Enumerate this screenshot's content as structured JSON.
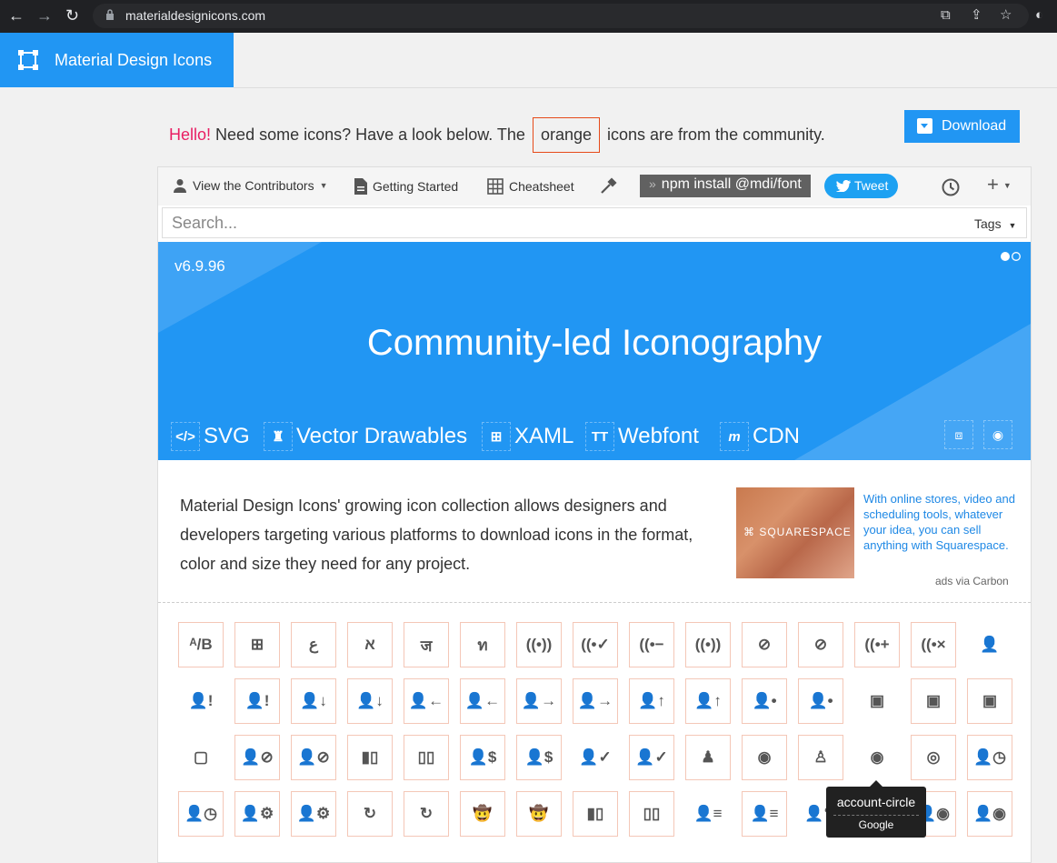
{
  "browser": {
    "url": "materialdesignicons.com"
  },
  "header": {
    "brand": "Material Design Icons"
  },
  "intro": {
    "hello": "Hello!",
    "before": "Need some icons? Have a look below. The",
    "orange": "orange",
    "after": "icons are from the community."
  },
  "download_label": "Download",
  "toolbar": {
    "contributors": "View the Contributors",
    "getting_started": "Getting Started",
    "cheatsheet": "Cheatsheet",
    "npm": "npm install @mdi/font",
    "tweet": "Tweet"
  },
  "search": {
    "placeholder": "Search...",
    "tags_label": "Tags"
  },
  "hero": {
    "version": "v6.9.96",
    "headline": "Community-led Iconography",
    "platforms": [
      "SVG",
      "Vector Drawables",
      "XAML",
      "Webfont",
      "CDN"
    ]
  },
  "description": "Material Design Icons' growing icon collection allows designers and developers targeting various platforms to download icons in the format, color and size they need for any project.",
  "ad": {
    "brand": "SQUARESPACE",
    "text": "With online stores, video and scheduling tools, whatever your idea, you can sell anything with Squarespace.",
    "via": "ads via Carbon"
  },
  "tooltip": {
    "name": "account-circle",
    "author": "Google"
  },
  "icon_rows": [
    [
      {
        "icon": "ab-testing-icon",
        "glyph": "ᴬ/B",
        "community": true
      },
      {
        "icon": "abacus-icon",
        "glyph": "⊞",
        "community": true
      },
      {
        "icon": "abjad-arabic-icon",
        "glyph": "ع",
        "community": true
      },
      {
        "icon": "abjad-hebrew-icon",
        "glyph": "א",
        "community": true
      },
      {
        "icon": "abugida-devanagari-icon",
        "glyph": "ज",
        "community": true
      },
      {
        "icon": "abugida-thai-icon",
        "glyph": "ท",
        "community": true
      },
      {
        "icon": "access-point-icon",
        "glyph": "((•))",
        "community": true
      },
      {
        "icon": "access-point-check-icon",
        "glyph": "((•✓",
        "community": true
      },
      {
        "icon": "access-point-minus-icon",
        "glyph": "((•−",
        "community": true
      },
      {
        "icon": "access-point-network-icon",
        "glyph": "((•))",
        "community": true
      },
      {
        "icon": "access-point-network-off-icon",
        "glyph": "⊘",
        "community": true
      },
      {
        "icon": "access-point-off-icon",
        "glyph": "⊘",
        "community": true
      },
      {
        "icon": "access-point-plus-icon",
        "glyph": "((•+",
        "community": true
      },
      {
        "icon": "access-point-remove-icon",
        "glyph": "((•×",
        "community": true
      },
      {
        "icon": "account-icon",
        "glyph": "👤",
        "community": false
      }
    ],
    [
      {
        "icon": "account-alert-icon",
        "glyph": "👤!",
        "community": false
      },
      {
        "icon": "account-alert-outline-icon",
        "glyph": "👤!",
        "community": true
      },
      {
        "icon": "account-arrow-down-icon",
        "glyph": "👤↓",
        "community": true
      },
      {
        "icon": "account-arrow-down-outline-icon",
        "glyph": "👤↓",
        "community": true
      },
      {
        "icon": "account-arrow-left-icon",
        "glyph": "👤←",
        "community": true
      },
      {
        "icon": "account-arrow-left-outline-icon",
        "glyph": "👤←",
        "community": true
      },
      {
        "icon": "account-arrow-right-icon",
        "glyph": "👤→",
        "community": true
      },
      {
        "icon": "account-arrow-right-outline-icon",
        "glyph": "👤→",
        "community": true
      },
      {
        "icon": "account-arrow-up-icon",
        "glyph": "👤↑",
        "community": true
      },
      {
        "icon": "account-arrow-up-outline-icon",
        "glyph": "👤↑",
        "community": true
      },
      {
        "icon": "account-badge-icon",
        "glyph": "👤•",
        "community": true
      },
      {
        "icon": "account-badge-outline-icon",
        "glyph": "👤•",
        "community": true
      },
      {
        "icon": "account-box-icon",
        "glyph": "▣",
        "community": false
      },
      {
        "icon": "account-box-multiple-icon",
        "glyph": "▣",
        "community": true
      },
      {
        "icon": "account-box-multiple-outline-icon",
        "glyph": "▣",
        "community": true
      }
    ],
    [
      {
        "icon": "account-box-outline-icon",
        "glyph": "▢",
        "community": false
      },
      {
        "icon": "account-cancel-icon",
        "glyph": "👤⊘",
        "community": true
      },
      {
        "icon": "account-cancel-outline-icon",
        "glyph": "👤⊘",
        "community": true
      },
      {
        "icon": "account-card-icon",
        "glyph": "▮▯",
        "community": true
      },
      {
        "icon": "account-card-outline-icon",
        "glyph": "▯▯",
        "community": true
      },
      {
        "icon": "account-cash-icon",
        "glyph": "👤$",
        "community": true
      },
      {
        "icon": "account-cash-outline-icon",
        "glyph": "👤$",
        "community": true
      },
      {
        "icon": "account-check-icon",
        "glyph": "👤✓",
        "community": false
      },
      {
        "icon": "account-check-outline-icon",
        "glyph": "👤✓",
        "community": true
      },
      {
        "icon": "account-child-icon",
        "glyph": "♟",
        "community": true
      },
      {
        "icon": "account-child-circle-icon",
        "glyph": "◉",
        "community": true
      },
      {
        "icon": "account-child-outline-icon",
        "glyph": "♙",
        "community": true
      },
      {
        "icon": "account-circle-icon",
        "glyph": "◉",
        "community": false
      },
      {
        "icon": "account-circle-outline-icon",
        "glyph": "◎",
        "community": true
      },
      {
        "icon": "account-clock-icon",
        "glyph": "👤◷",
        "community": true
      }
    ],
    [
      {
        "icon": "account-clock-outline-icon",
        "glyph": "👤◷",
        "community": true
      },
      {
        "icon": "account-cog-icon",
        "glyph": "👤⚙",
        "community": true
      },
      {
        "icon": "account-cog-outline-icon",
        "glyph": "👤⚙",
        "community": true
      },
      {
        "icon": "account-convert-icon",
        "glyph": "↻",
        "community": true
      },
      {
        "icon": "account-convert-outline-icon",
        "glyph": "↻",
        "community": true
      },
      {
        "icon": "account-cowboy-hat-icon",
        "glyph": "🤠",
        "community": true
      },
      {
        "icon": "account-cowboy-hat-outline-icon",
        "glyph": "🤠",
        "community": true
      },
      {
        "icon": "account-credit-card-icon",
        "glyph": "▮▯",
        "community": true
      },
      {
        "icon": "account-credit-card-outline-icon",
        "glyph": "▯▯",
        "community": true
      },
      {
        "icon": "account-details-icon",
        "glyph": "👤≡",
        "community": false
      },
      {
        "icon": "account-details-outline-icon",
        "glyph": "👤≡",
        "community": true
      },
      {
        "icon": "account-edit-icon",
        "glyph": "👤✎",
        "community": false
      },
      {
        "icon": "account-edit-outline-icon",
        "glyph": "👤✎",
        "community": true
      },
      {
        "icon": "account-eye-icon",
        "glyph": "👤◉",
        "community": true
      },
      {
        "icon": "account-eye-outline-icon",
        "glyph": "👤◉",
        "community": true
      }
    ]
  ]
}
